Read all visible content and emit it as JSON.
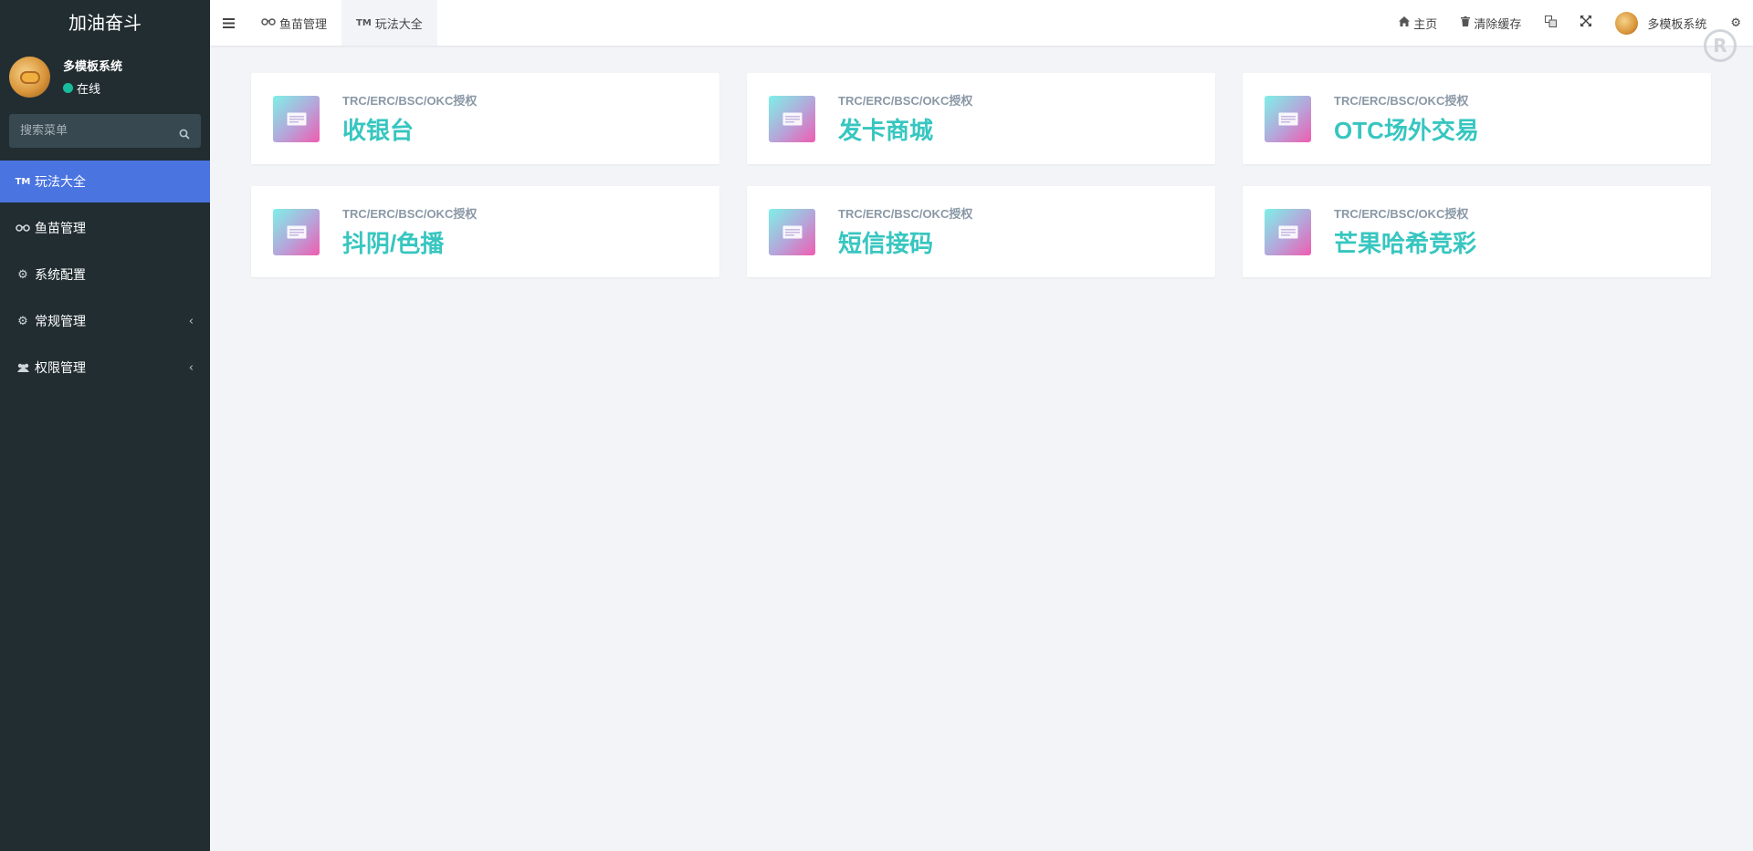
{
  "app": {
    "title": "加油奋斗",
    "watermark": "R"
  },
  "user": {
    "name": "多模板系统",
    "status": "在线",
    "status_color": "#18bc9c"
  },
  "search": {
    "placeholder": "搜索菜单"
  },
  "sidebar": {
    "items": [
      {
        "label": "玩法大全",
        "icon": "trademark-icon",
        "glyph": "TM",
        "active": true
      },
      {
        "label": "鱼苗管理",
        "icon": "binoculars-icon",
        "glyph": "∞",
        "active": false
      },
      {
        "label": "系统配置",
        "icon": "gear-icon",
        "glyph": "⚙",
        "active": false
      },
      {
        "label": "常规管理",
        "icon": "cogs-icon",
        "glyph": "⚙",
        "active": false,
        "arrow": "‹"
      },
      {
        "label": "权限管理",
        "icon": "users-icon",
        "glyph": "👥",
        "active": false,
        "arrow": "‹"
      }
    ]
  },
  "topbar": {
    "tabs": [
      {
        "label": "鱼苗管理",
        "glyph": "∞"
      },
      {
        "label": "玩法大全",
        "glyph": "TM"
      }
    ],
    "home": "主页",
    "clear_cache": "清除缓存",
    "user_name": "多模板系统"
  },
  "cards": [
    {
      "sub": "TRC/ERC/BSC/OKC授权",
      "title": "收银台"
    },
    {
      "sub": "TRC/ERC/BSC/OKC授权",
      "title": "发卡商城"
    },
    {
      "sub": "TRC/ERC/BSC/OKC授权",
      "title": "OTC场外交易"
    },
    {
      "sub": "TRC/ERC/BSC/OKC授权",
      "title": "抖阴/色播"
    },
    {
      "sub": "TRC/ERC/BSC/OKC授权",
      "title": "短信接码"
    },
    {
      "sub": "TRC/ERC/BSC/OKC授权",
      "title": "芒果哈希竞彩"
    }
  ],
  "colors": {
    "sidebar_bg": "#222d32",
    "active_menu": "#4a74e0",
    "card_title": "#37c6c0"
  }
}
